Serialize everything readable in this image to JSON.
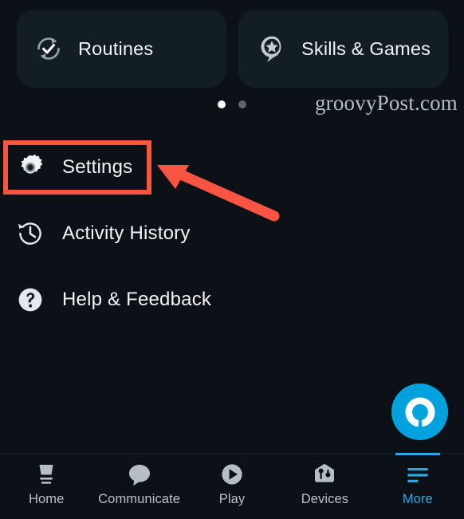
{
  "app": {
    "name": "Amazon Alexa",
    "screen": "More",
    "background_color": "#0b1116",
    "accent_color": "#2fa8e0",
    "highlight_color": "#fa5542"
  },
  "cards": [
    {
      "label": "Routines",
      "icon": "routines-refresh-check-icon"
    },
    {
      "label": "Skills & Games",
      "icon": "skills-games-pin-star-icon"
    }
  ],
  "pager": {
    "dots": [
      {
        "state": "active"
      },
      {
        "state": "inactive"
      }
    ]
  },
  "watermark": {
    "text": "groovyPost.com"
  },
  "menu": {
    "items": [
      {
        "label": "Settings",
        "icon": "gear-icon",
        "highlighted": true
      },
      {
        "label": "Activity History",
        "icon": "clock-history-icon",
        "highlighted": false
      },
      {
        "label": "Help & Feedback",
        "icon": "question-mark-circle-icon",
        "highlighted": false
      }
    ]
  },
  "annotation": {
    "arrow": {
      "color": "#fa5542",
      "points_to": "Settings"
    },
    "box": {
      "color": "#fa5542",
      "around": "Settings"
    }
  },
  "fab": {
    "label": "Alexa",
    "icon": "alexa-ring-icon",
    "color": "#00a2dd"
  },
  "bottom_nav": {
    "items": [
      {
        "label": "Home",
        "icon": "echo-device-icon",
        "active": false
      },
      {
        "label": "Communicate",
        "icon": "speech-bubble-icon",
        "active": false
      },
      {
        "label": "Play",
        "icon": "play-circle-icon",
        "active": false
      },
      {
        "label": "Devices",
        "icon": "devices-house-icon",
        "active": false
      },
      {
        "label": "More",
        "icon": "hamburger-menu-icon",
        "active": true
      }
    ]
  }
}
